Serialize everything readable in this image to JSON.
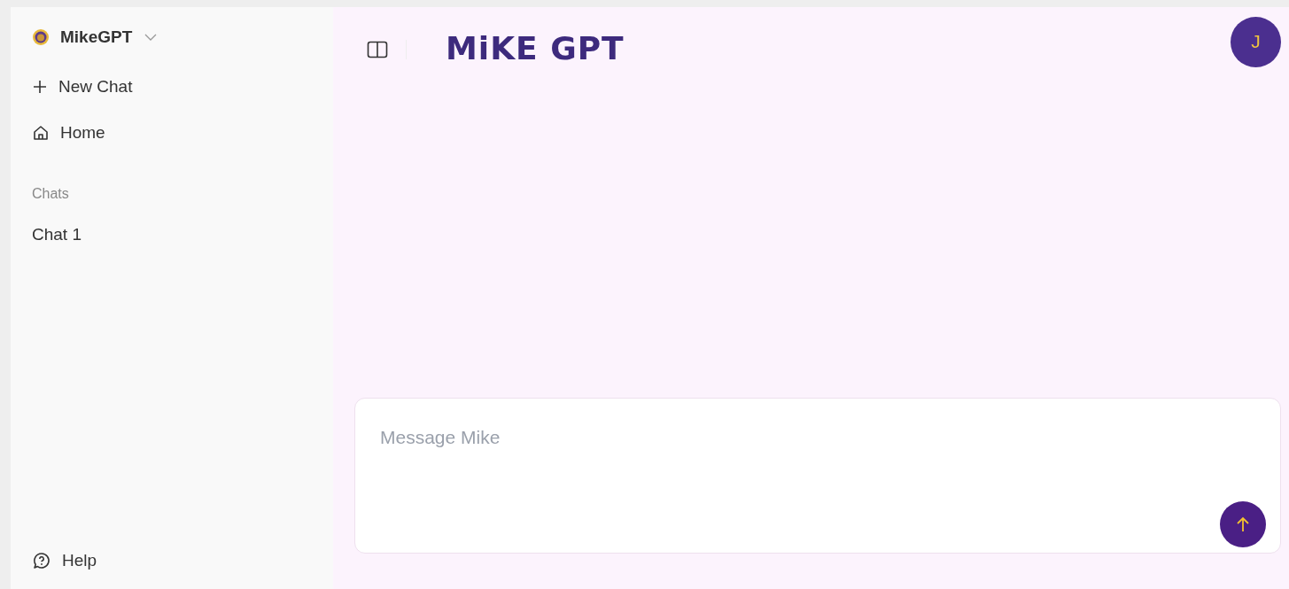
{
  "sidebar": {
    "workspace": "MikeGPT",
    "actions": [
      {
        "kind": "new",
        "label": "New Chat"
      },
      {
        "kind": "home",
        "label": "Home"
      }
    ],
    "section_title": "Chats",
    "chats": [
      {
        "label": "Chat 1",
        "selected": false
      }
    ],
    "help": "Help"
  },
  "header": {
    "logo": "MiKE GPT",
    "avatar": "J"
  },
  "composer": {
    "placeholder": "Message Mike"
  }
}
